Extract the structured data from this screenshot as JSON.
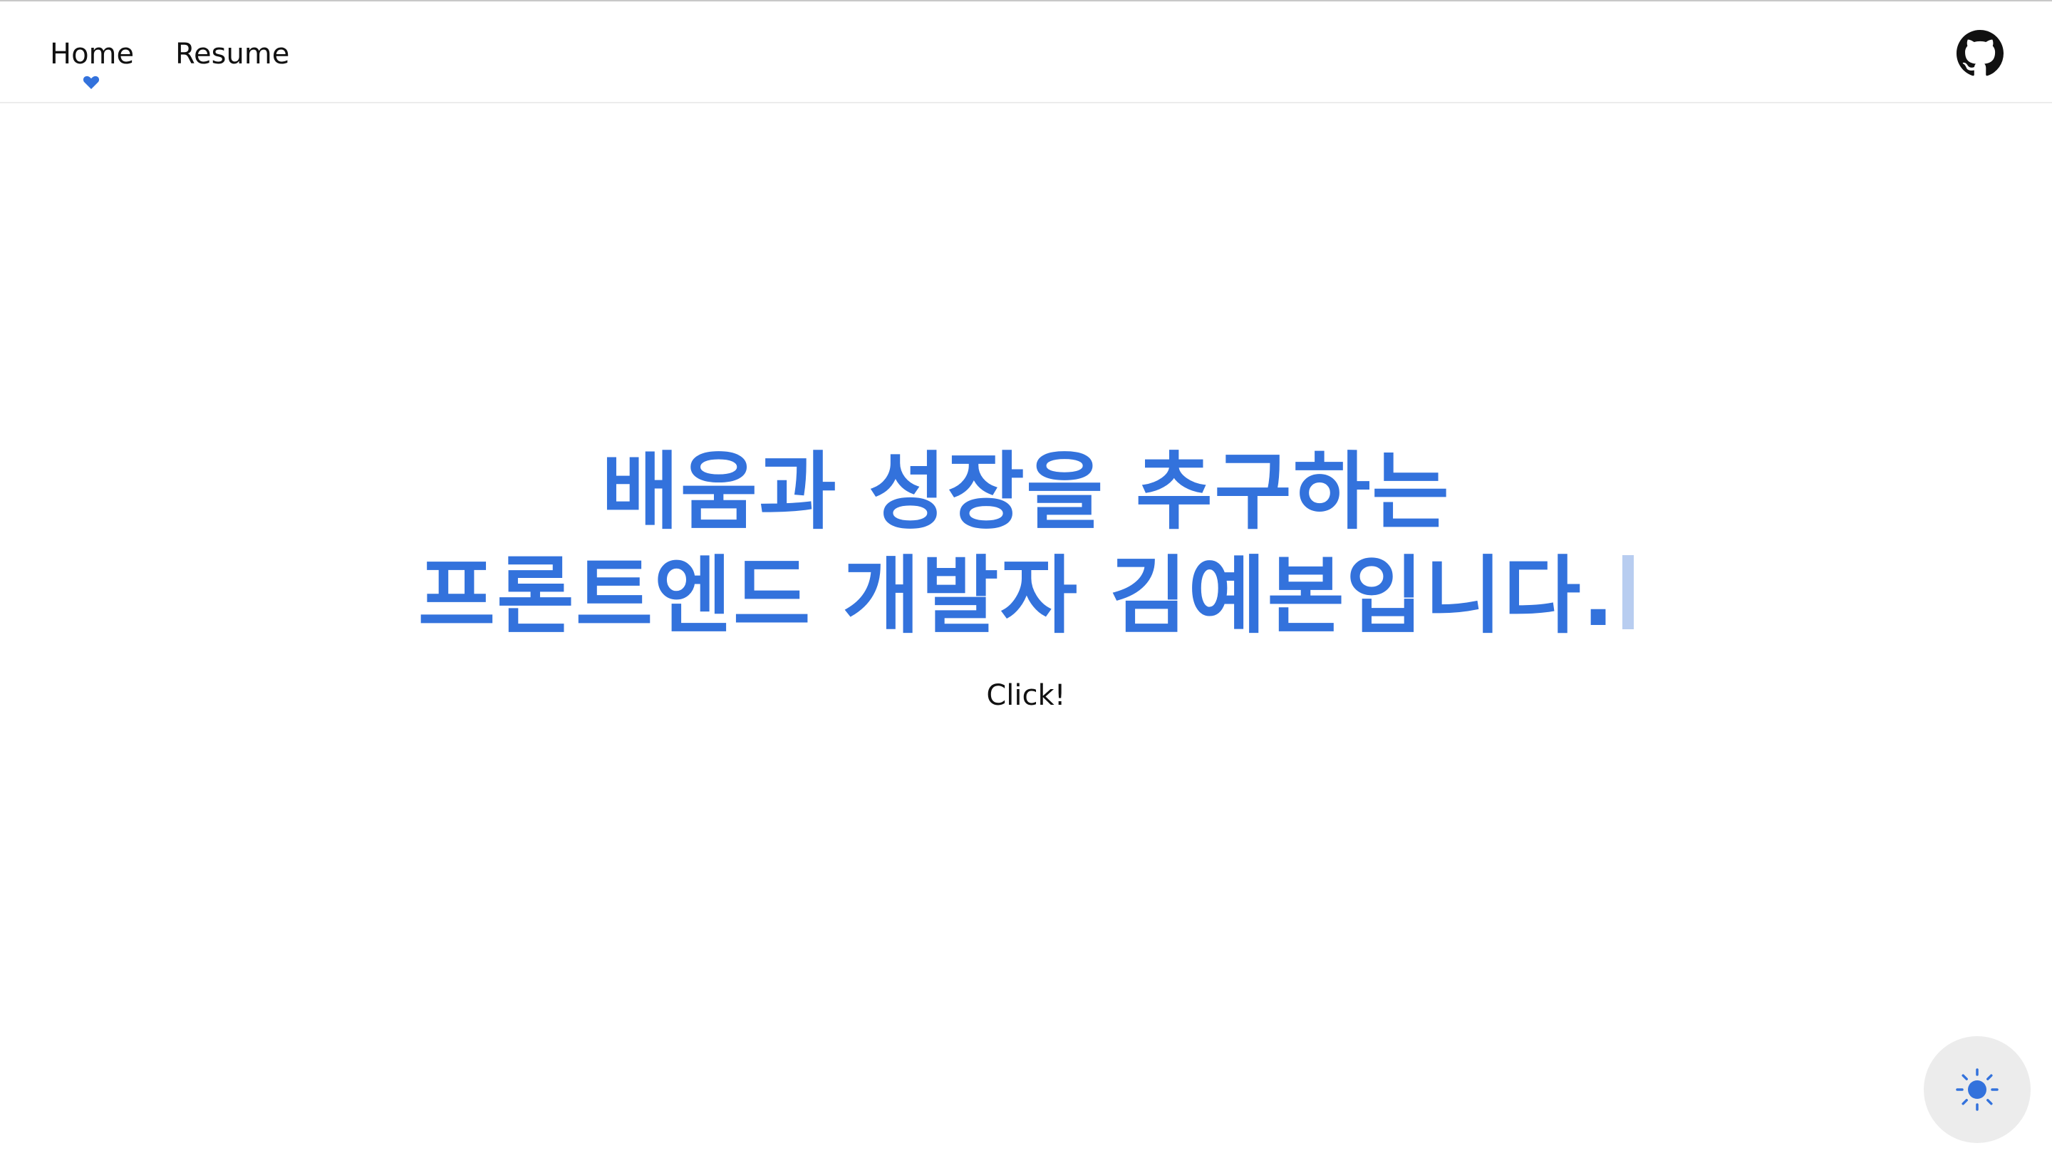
{
  "nav": {
    "items": [
      {
        "label": "Home",
        "active": true
      },
      {
        "label": "Resume",
        "active": false
      }
    ],
    "active_indicator_icon": "heart-icon",
    "github_icon": "github-icon"
  },
  "hero": {
    "line1": "배움과 성장을 추구하는",
    "line2": "프론트엔드 개발자 김예본입니다."
  },
  "cta": {
    "label": "Click!"
  },
  "theme_toggle": {
    "icon": "sun-icon"
  },
  "colors": {
    "accent": "#3372dc",
    "text": "#111111",
    "toggle_bg": "#ececec",
    "cursor": "#b8cdf0"
  }
}
